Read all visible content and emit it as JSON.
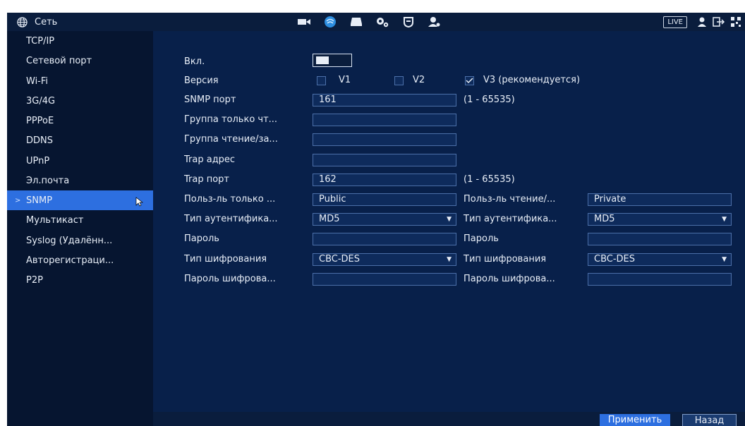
{
  "topbar": {
    "title": "Сеть",
    "icons": [
      "camera-icon",
      "network-icon",
      "storage-icon",
      "system-settings-icon",
      "security-icon",
      "account-icon"
    ],
    "live": "LIVE",
    "right_icons": [
      "user-icon",
      "logout-icon",
      "qr-code-icon"
    ]
  },
  "sidebar": {
    "items": [
      {
        "label": "TCP/IP"
      },
      {
        "label": "Сетевой порт"
      },
      {
        "label": "Wi-Fi"
      },
      {
        "label": "3G/4G"
      },
      {
        "label": "PPPoE"
      },
      {
        "label": "DDNS"
      },
      {
        "label": "UPnP"
      },
      {
        "label": "Эл.почта"
      },
      {
        "label": "SNMP",
        "active": true
      },
      {
        "label": "Мультикаст"
      },
      {
        "label": "Syslog (Удалённ..."
      },
      {
        "label": "Авторегистраци..."
      },
      {
        "label": "P2P"
      }
    ]
  },
  "form": {
    "enable_label": "Вкл.",
    "version_label": "Версия",
    "v1": "V1",
    "v2": "V2",
    "v3": "V3 (рекомендуется)",
    "snmp_port_label": "SNMP порт",
    "snmp_port_value": "161",
    "port_range": "(1 - 65535)",
    "read_group_label": "Группа только чт...",
    "rw_group_label": "Группа чтение/за...",
    "trap_addr_label": "Trap адрес",
    "trap_port_label": "Trap порт",
    "trap_port_value": "162",
    "trap_port_range": "(1 - 65535)",
    "ro_user_label": "Польз-ль только ...",
    "ro_user_value": "Public",
    "rw_user_label": "Польз-ль чтение/...",
    "rw_user_value": "Private",
    "auth_type_label": "Тип аутентифика...",
    "auth_type_value": "MD5",
    "auth_type_label2": "Тип аутентифика...",
    "auth_type_value2": "MD5",
    "password_label": "Пароль",
    "password_label2": "Пароль",
    "enc_type_label": "Тип шифрования",
    "enc_type_value": "CBC-DES",
    "enc_type_label2": "Тип шифрования",
    "enc_type_value2": "CBC-DES",
    "enc_pass_label": "Пароль шифрова...",
    "enc_pass_label2": "Пароль шифрова..."
  },
  "buttons": {
    "apply": "Применить",
    "back": "Назад"
  },
  "colors": {
    "accent": "#2d6fe0",
    "background": "#071834",
    "field": "#0e2b5c"
  }
}
